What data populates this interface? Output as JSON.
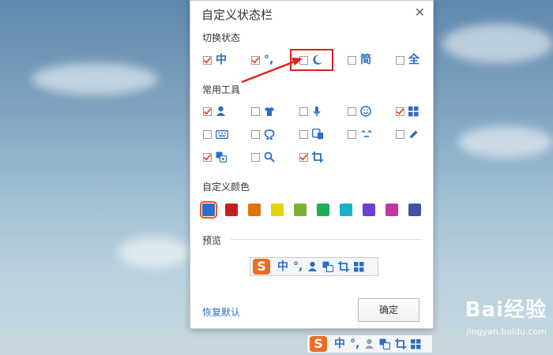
{
  "dialog": {
    "title": "自定义状态栏",
    "close": "✕",
    "switch_section": "切换状态",
    "switch_items": [
      {
        "icon": "chinese-mode-icon",
        "text": "中",
        "checked": true
      },
      {
        "icon": "punctuation-icon",
        "text": "°,",
        "checked": true
      },
      {
        "icon": "moon-icon",
        "text": "",
        "checked": false
      },
      {
        "icon": "simplified-icon",
        "text": "简",
        "checked": false
      },
      {
        "icon": "fullwidth-icon",
        "text": "全",
        "checked": false
      }
    ],
    "tools_section": "常用工具",
    "tools_items": [
      {
        "icon": "user-icon",
        "checked": true
      },
      {
        "icon": "shirt-icon",
        "checked": false
      },
      {
        "icon": "microphone-icon",
        "checked": false
      },
      {
        "icon": "smiley-icon",
        "checked": false
      },
      {
        "icon": "grid-icon",
        "checked": true
      },
      {
        "icon": "keyboard-icon",
        "checked": false
      },
      {
        "icon": "omega-icon",
        "checked": false
      },
      {
        "icon": "devices-icon",
        "checked": false
      },
      {
        "icon": "emoticon-icon",
        "checked": false
      },
      {
        "icon": "pen-icon",
        "checked": false
      },
      {
        "icon": "translate-icon",
        "checked": true
      },
      {
        "icon": "search-icon",
        "checked": false
      },
      {
        "icon": "crop-icon",
        "checked": true
      }
    ],
    "color_section": "自定义颜色",
    "colors": [
      "#2d6fc6",
      "#c81d1d",
      "#e2740f",
      "#e2d400",
      "#79b331",
      "#21ad58",
      "#16b2c6",
      "#6a3fd8",
      "#c236a3",
      "#3f53a0"
    ],
    "selected_color": 0,
    "preview_label": "预览",
    "restore_label": "恢复默认",
    "ok_label": "确定"
  },
  "toolbar": {
    "logo": "S",
    "chinese": "中",
    "punct": "°,"
  },
  "watermark": {
    "brand": "Bai经验",
    "url": "jingyan.baidu.com"
  }
}
